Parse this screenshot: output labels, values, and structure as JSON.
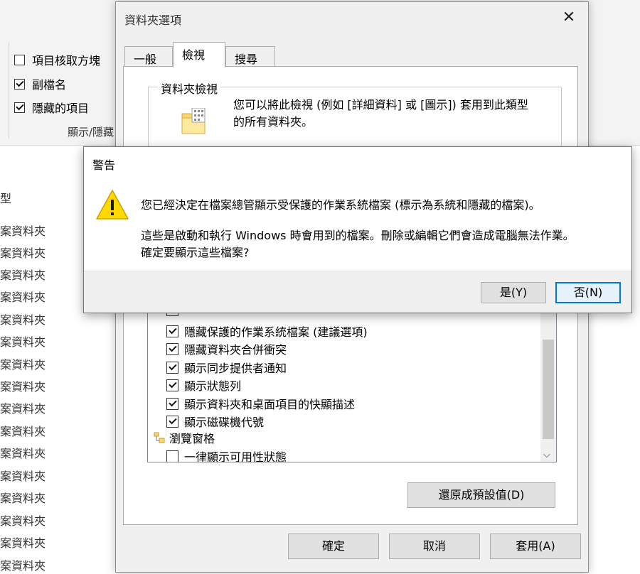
{
  "explorer": {
    "ribbon": {
      "checks": [
        {
          "label": "項目核取方塊",
          "checked": false
        },
        {
          "label": "副檔名",
          "checked": true
        },
        {
          "label": "隱藏的項目",
          "checked": true
        }
      ],
      "group_label": "顯示/隱藏"
    },
    "list": {
      "type_header": "類型",
      "rows": [
        "檔案資料夾",
        "檔案資料夾",
        "檔案資料夾",
        "檔案資料夾",
        "檔案資料夾",
        "檔案資料夾",
        "檔案資料夾",
        "檔案資料夾",
        "檔案資料夾",
        "檔案資料夾",
        "檔案資料夾",
        "檔案資料夾",
        "檔案資料夾",
        "檔案資料夾",
        "檔案資料夾",
        "檔案資料夾"
      ]
    }
  },
  "folder_options": {
    "title": "資料夾選項",
    "tabs": [
      {
        "label": "一般",
        "active": false
      },
      {
        "label": "檢視",
        "active": true
      },
      {
        "label": "搜尋",
        "active": false
      }
    ],
    "folder_view": {
      "title": "資料夾檢視",
      "description_line1": "您可以將此檢視 (例如 [詳細資料] 或 [圖示]) 套用到此類型",
      "description_line2": "的所有資料夾。"
    },
    "advanced": {
      "items": [
        {
          "label": "隱藏保護的作業系統檔案 (建議選項)",
          "checked": true
        },
        {
          "label": "隱藏資料夾合併衝突",
          "checked": true
        },
        {
          "label": "顯示同步提供者通知",
          "checked": true
        },
        {
          "label": "顯示狀態列",
          "checked": true
        },
        {
          "label": "顯示資料夾和桌面項目的快顯描述",
          "checked": true
        },
        {
          "label": "顯示磁碟機代號",
          "checked": true
        }
      ],
      "nav_pane_label": "瀏覽窗格",
      "last_item": {
        "label": "一律顯示可用性狀態",
        "checked": false
      }
    },
    "restore_label": "還原成預設值(D)",
    "ok_label": "確定",
    "cancel_label": "取消",
    "apply_label": "套用(A)"
  },
  "warning": {
    "title": "警告",
    "message_line1": "您已經決定在檔案總管顯示受保護的作業系統檔案 (標示為系統和隱藏的檔案)。",
    "message_line2": "這些是啟動和執行 Windows 時會用到的檔案。刪除或編輯它們會造成電腦無法作業。",
    "message_line3": "確定要顯示這些檔案?",
    "yes_label": "是(Y)",
    "no_label": "否(N)",
    "icon": "warning-triangle-icon",
    "accent_color": "#0078d7"
  }
}
